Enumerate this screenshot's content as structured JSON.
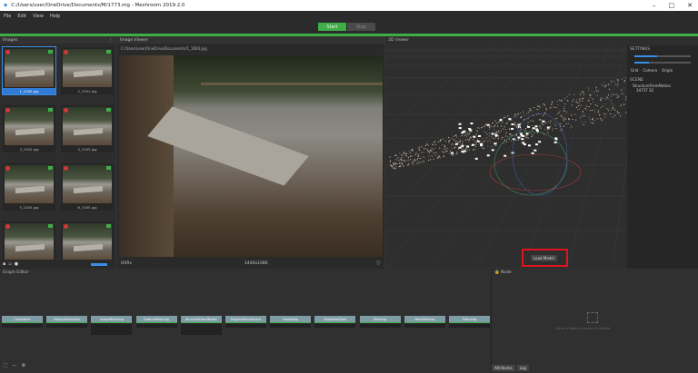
{
  "window": {
    "title": "C:/Users/user/OneDrive/Documents/M/1773.mg - Meshroom 2019.2.0"
  },
  "menu": [
    "File",
    "Edit",
    "View",
    "Help"
  ],
  "toolbar": {
    "start": "Start",
    "stop": "Stop",
    "accent": "#3fae49"
  },
  "images_panel": {
    "title": "Images",
    "thumbnails": [
      "1_1000.jpg",
      "2_1001.jpg",
      "3_1002.jpg",
      "4_1003.jpg",
      "5_1004.jpg",
      "6_1005.jpg",
      "7_1006.jpg",
      "8_1007.jpg"
    ],
    "selected_index": 0
  },
  "image_viewer": {
    "title": "Image Viewer",
    "path": "C:/Users/user/OneDrive/Documents/1_1000.jpg",
    "footer_left": "UVRs",
    "footer_center": "1440x1080"
  },
  "viewer3d": {
    "title": "3D Viewer",
    "load_model": "Load Model"
  },
  "settings": {
    "title": "SETTINGS",
    "grid": "Grid",
    "camera": "Camera",
    "origin": "Origin",
    "scene_title": "SCENE",
    "scene_item": "StructureFromMotion",
    "scene_counts": "34737   32"
  },
  "graph": {
    "title": "Graph Editor",
    "nodes": [
      "CameraInit",
      "FeatureExtraction",
      "ImageMatching",
      "FeatureMatching",
      "StructureFromMotion",
      "PrepareDenseScene",
      "DepthMap",
      "DepthMapFilter",
      "Meshing",
      "MeshFiltering",
      "Texturing"
    ]
  },
  "node_panel": {
    "title": "Node",
    "empty_text": "Select a Node to access its Details",
    "attributes_tab": "Attributes",
    "log_tab": "Log"
  }
}
